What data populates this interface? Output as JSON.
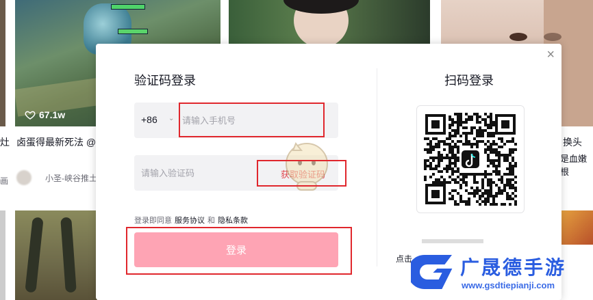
{
  "feed": {
    "tile1": {
      "likes": "67.1w",
      "title": "卤蛋得最新死法 @",
      "author": "小圣-峡谷推土"
    },
    "left_partial_title": "灶",
    "left_partial_author": "画",
    "right_partial_title_1": "换头",
    "right_partial_title_2": "是血嫩根"
  },
  "modal": {
    "close_label": "×",
    "sms_login": {
      "title": "验证码登录",
      "country_code": "+86",
      "phone_placeholder": "请输入手机号",
      "code_placeholder": "请输入验证码",
      "get_code_label": "获取验证码",
      "agree_prefix": "登录即同意",
      "terms_label": "服务协议",
      "and_label": "和",
      "privacy_label": "隐私条款",
      "login_button": "登录"
    },
    "qr_login": {
      "title": "扫码登录",
      "hint_partial": "点击"
    }
  },
  "watermark": {
    "name": "广晟德手游",
    "url": "www.gsdtiepianji.com"
  },
  "colors": {
    "accent": "#fe2c55",
    "login_button": "#fea4b4",
    "get_code": "#e0484f",
    "annotation": "#e0262c"
  }
}
